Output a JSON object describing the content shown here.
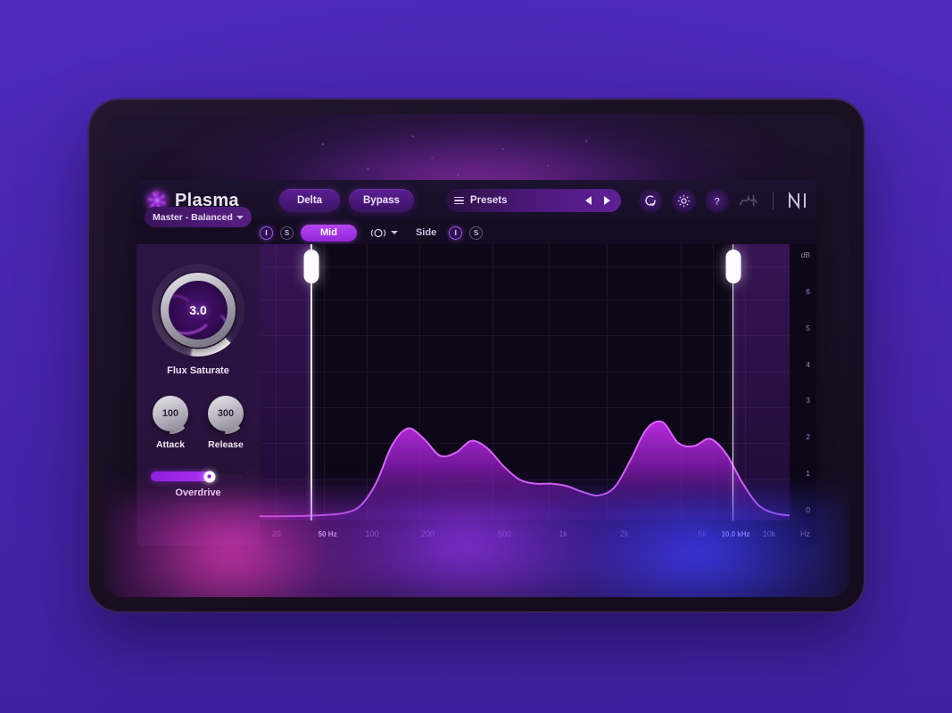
{
  "app": {
    "brand_name": "Plasma",
    "logo_icon": "plasma-swirl-icon"
  },
  "header": {
    "delta_label": "Delta",
    "bypass_label": "Bypass",
    "presets_label": "Presets",
    "presets_list_icon": "list-icon",
    "prev_icon": "triangle-left-icon",
    "next_icon": "triangle-right-icon",
    "undo_icon": "circular-arrow-icon",
    "settings_icon": "gear-icon",
    "help_icon": "question-mark-icon",
    "squiggle_icon": "waveform-squiggle-icon",
    "ni_logo_icon": "native-instruments-logo-icon"
  },
  "channel_bar": {
    "left_mute_label": "I",
    "left_solo_label": "S",
    "mid_label": "Mid",
    "stereo_icon": "stereo-link-icon",
    "stereo_chevron_icon": "chevron-down-icon",
    "side_label": "Side",
    "right_mute_label": "I",
    "right_solo_label": "S"
  },
  "left_panel": {
    "preset_selector": {
      "value": "Master - Balanced",
      "chevron_icon": "chevron-down-icon"
    },
    "main_knob": {
      "value": "3.0",
      "label": "Flux Saturate",
      "percent": 62
    },
    "small_knobs": [
      {
        "value": "100",
        "label": "Attack"
      },
      {
        "value": "300",
        "label": "Release"
      }
    ],
    "slider": {
      "label": "Overdrive",
      "percent": 62
    }
  },
  "chart_data": {
    "type": "area",
    "title": "",
    "xlabel": "Hz",
    "ylabel": "dB",
    "grid": true,
    "legend": "none",
    "x_ticks": [
      {
        "label": "20",
        "pos": 3.0,
        "highlight": false
      },
      {
        "label": "50 Hz",
        "pos": 12.2,
        "highlight": true
      },
      {
        "label": "100",
        "pos": 20.2,
        "highlight": false
      },
      {
        "label": "200",
        "pos": 30.2,
        "highlight": false
      },
      {
        "label": "500",
        "pos": 44.0,
        "highlight": false
      },
      {
        "label": "1k",
        "pos": 54.5,
        "highlight": false
      },
      {
        "label": "2k",
        "pos": 65.5,
        "highlight": false
      },
      {
        "label": "5k",
        "pos": 79.5,
        "highlight": false
      },
      {
        "label": "10.0 kHz",
        "pos": 85.5,
        "highlight": true
      },
      {
        "label": "10k",
        "pos": 91.5,
        "highlight": false
      }
    ],
    "y_ticks": [
      "dB",
      "6",
      "5",
      "4",
      "3",
      "2",
      "1",
      "0"
    ],
    "ylim": [
      0,
      6.6
    ],
    "low_band_hz": "50 Hz",
    "high_band_hz": "10.0 kHz",
    "low_band_pos_pct": 9.6,
    "high_band_pos_pct": 89.2,
    "series": [
      {
        "name": "Spectrum",
        "x_pct": [
          0,
          4,
          8,
          12,
          16,
          19,
          22,
          25,
          28,
          31,
          34,
          37,
          40,
          43,
          46,
          49,
          52,
          55,
          58,
          61,
          64,
          67,
          70,
          73,
          76,
          79,
          82,
          85,
          88,
          91,
          94,
          97,
          100
        ],
        "y_db": [
          0.1,
          0.1,
          0.11,
          0.13,
          0.18,
          0.35,
          0.9,
          1.8,
          2.2,
          1.95,
          1.55,
          1.62,
          1.9,
          1.72,
          1.3,
          0.98,
          0.88,
          0.88,
          0.82,
          0.68,
          0.6,
          0.8,
          1.45,
          2.18,
          2.35,
          1.85,
          1.78,
          1.95,
          1.6,
          0.92,
          0.38,
          0.18,
          0.12
        ]
      }
    ]
  }
}
